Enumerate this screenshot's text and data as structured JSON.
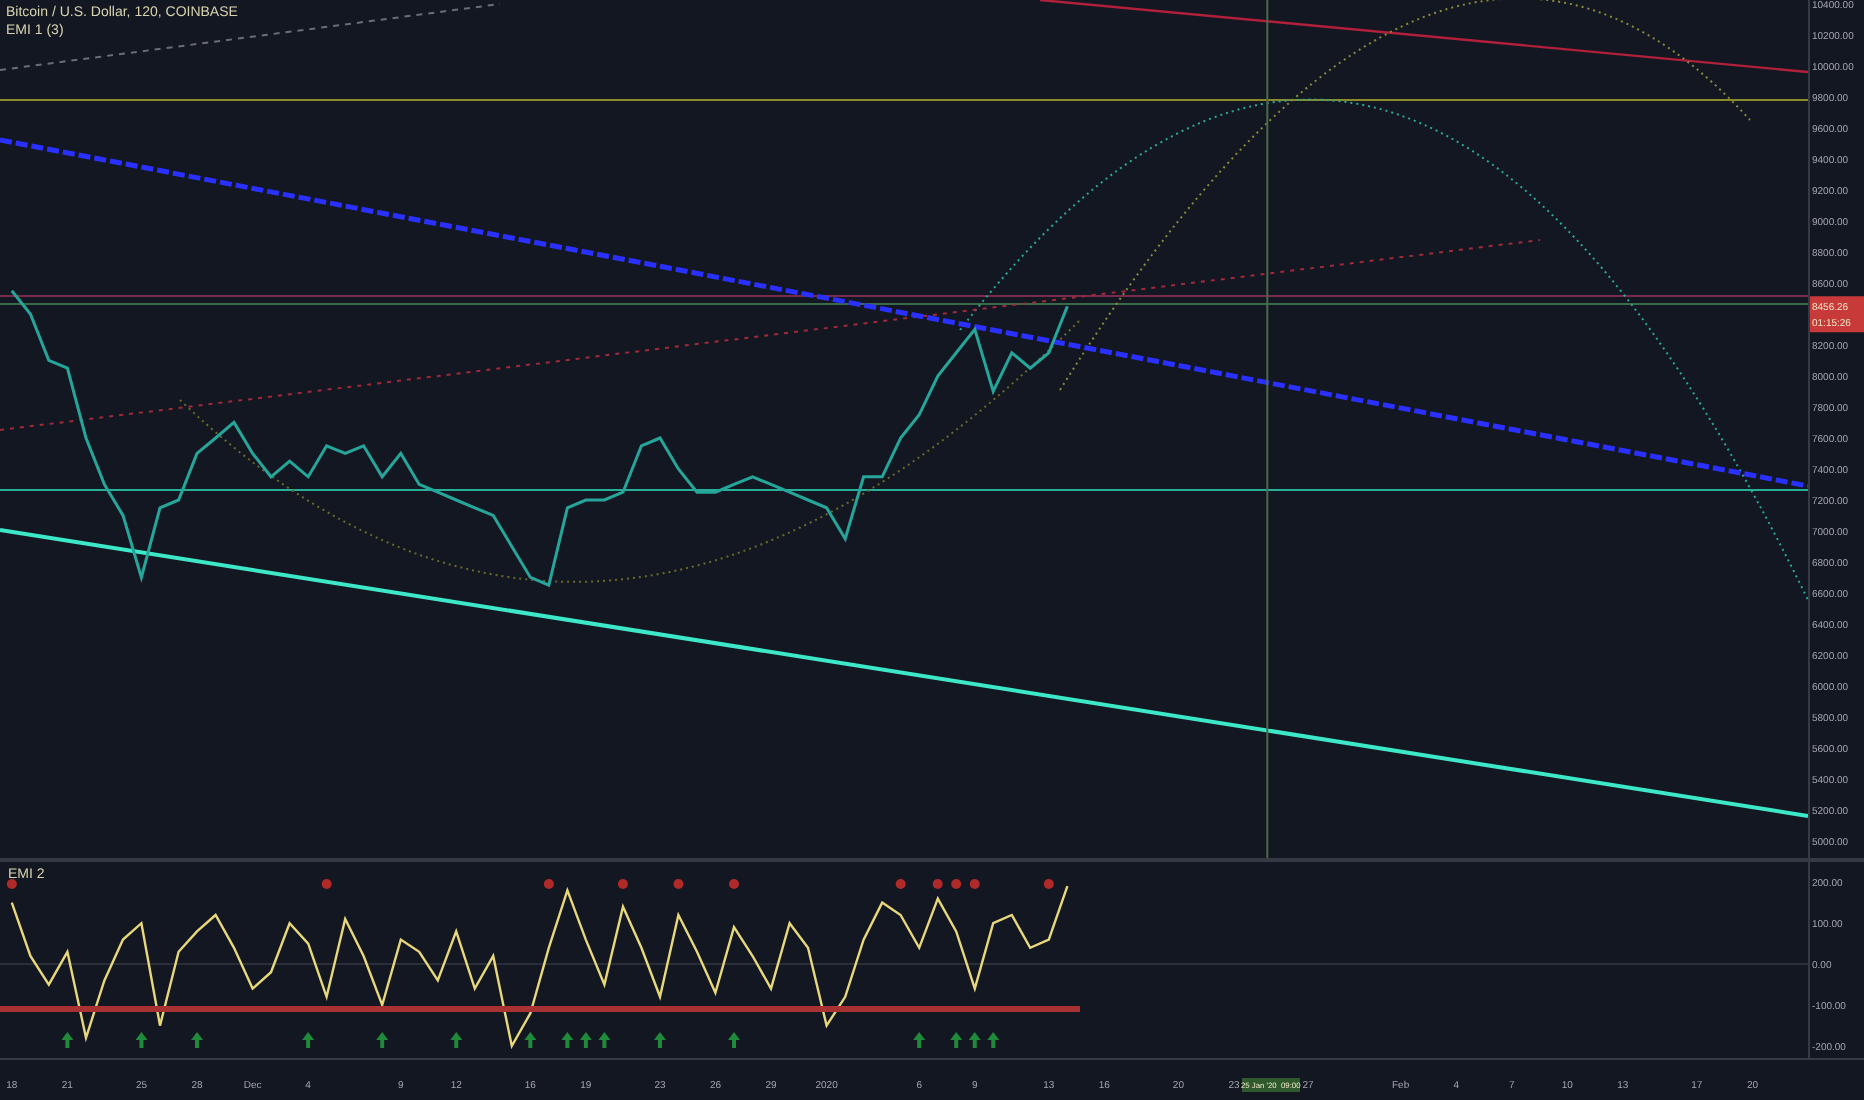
{
  "header": {
    "title": "Bitcoin / U.S. Dollar, 120, COINBASE",
    "indicator": "EMI 1 (3)"
  },
  "main_chart": {
    "chart_data": {
      "type": "line",
      "ylim": [
        4877,
        10426
      ],
      "categories": [
        null,
        null,
        null,
        null,
        null,
        null,
        null,
        null,
        null,
        null,
        null,
        null,
        null,
        null,
        null,
        null,
        null,
        null,
        null,
        null,
        null,
        null,
        null,
        null,
        null,
        null,
        null,
        null,
        null,
        null,
        null,
        null,
        null,
        null,
        null,
        null,
        null,
        null,
        null,
        null,
        null,
        null,
        null,
        null,
        null,
        null,
        null,
        null,
        null,
        null,
        null,
        null,
        null,
        null,
        null,
        null,
        null,
        null
      ],
      "series": [
        {
          "color": "#26a69a",
          "values": [
            8550,
            8400,
            8100,
            8050,
            7600,
            7300,
            7100,
            6700,
            7150,
            7200,
            7500,
            7600,
            7700,
            7500,
            7350,
            7450,
            7350,
            7550,
            7500,
            7550,
            7350,
            7500,
            7300,
            7250,
            7200,
            7150,
            7100,
            6900,
            6700,
            6650,
            7150,
            7200,
            7200,
            7250,
            7550,
            7600,
            7400,
            7250,
            7250,
            7300,
            7350,
            7300,
            7250,
            7200,
            7150,
            6950,
            7350,
            7350,
            7600,
            7750,
            8000,
            8150,
            8300,
            7900,
            8150,
            8050,
            8150,
            8450
          ]
        }
      ],
      "yticks": [
        {
          "value": 10400,
          "label": "10400.00"
        },
        {
          "value": 10200,
          "label": "10200.00"
        },
        {
          "value": 10000,
          "label": "10000.00"
        },
        {
          "value": 9800,
          "label": "9800.00"
        },
        {
          "value": 9600,
          "label": "9600.00"
        },
        {
          "value": 9400,
          "label": "9400.00"
        },
        {
          "value": 9200,
          "label": "9200.00"
        },
        {
          "value": 9000,
          "label": "9000.00"
        },
        {
          "value": 8800,
          "label": "8800.00"
        },
        {
          "value": 8600,
          "label": "8600.00"
        },
        {
          "value": 8200,
          "label": "8200.00"
        },
        {
          "value": 8000,
          "label": "8000.00"
        },
        {
          "value": 7800,
          "label": "7800.00"
        },
        {
          "value": 7600,
          "label": "7600.00"
        },
        {
          "value": 7400,
          "label": "7400.00"
        },
        {
          "value": 7200,
          "label": "7200.00"
        },
        {
          "value": 7000,
          "label": "7000.00"
        },
        {
          "value": 6800,
          "label": "6800.00"
        },
        {
          "value": 6600,
          "label": "6600.00"
        },
        {
          "value": 6400,
          "label": "6400.00"
        },
        {
          "value": 6200,
          "label": "6200.00"
        },
        {
          "value": 6000,
          "label": "6000.00"
        },
        {
          "value": 5800,
          "label": "5800.00"
        },
        {
          "value": 5600,
          "label": "5600.00"
        },
        {
          "value": 5400,
          "label": "5400.00"
        },
        {
          "value": 5200,
          "label": "5200.00"
        },
        {
          "value": 5000,
          "label": "5000.00"
        }
      ]
    },
    "last_price": {
      "price": "8456.26",
      "countdown": "01:15:26"
    }
  },
  "time_axis": [
    "18",
    "21",
    "25",
    "28",
    "Dec",
    "4",
    "9",
    "12",
    "16",
    "19",
    "23",
    "26",
    "29",
    "2020",
    "6",
    "9",
    "13",
    "16",
    "20",
    "23",
    "27",
    "Feb",
    "4",
    "7",
    "10",
    "13",
    "17",
    "20"
  ],
  "crosshair": {
    "label": "25 Jan '20  09:00"
  },
  "indicator_pane": {
    "title": "EMI 2",
    "chart_data": {
      "type": "line",
      "ylim": [
        -234,
        254
      ],
      "categories": [
        null,
        null,
        null,
        null,
        null,
        null,
        null,
        null,
        null,
        null,
        null,
        null,
        null,
        null,
        null,
        null,
        null,
        null,
        null,
        null,
        null,
        null,
        null,
        null,
        null,
        null,
        null,
        null,
        null,
        null,
        null,
        null,
        null,
        null,
        null,
        null,
        null,
        null,
        null,
        null,
        null,
        null,
        null,
        null,
        null,
        null,
        null,
        null,
        null,
        null,
        null,
        null,
        null,
        null,
        null,
        null,
        null,
        null
      ],
      "series": [
        {
          "color": "#e8d87a",
          "values": [
            150,
            20,
            -50,
            30,
            -180,
            -40,
            60,
            100,
            -150,
            30,
            80,
            120,
            40,
            -60,
            -20,
            100,
            50,
            -80,
            110,
            20,
            -100,
            60,
            30,
            -40,
            80,
            -60,
            20,
            -200,
            -120,
            40,
            180,
            60,
            -50,
            140,
            40,
            -80,
            120,
            30,
            -70,
            90,
            20,
            -60,
            100,
            40,
            -150,
            -80,
            60,
            150,
            120,
            40,
            160,
            80,
            -60,
            100,
            120,
            40,
            60,
            190
          ]
        }
      ],
      "yticks": [
        {
          "value": 200,
          "label": "200.00"
        },
        {
          "value": 100,
          "label": "100.00"
        },
        {
          "value": 0,
          "label": "0.00"
        },
        {
          "value": -100,
          "label": "-100.00"
        },
        {
          "value": -200,
          "label": "-200.00"
        }
      ]
    }
  }
}
